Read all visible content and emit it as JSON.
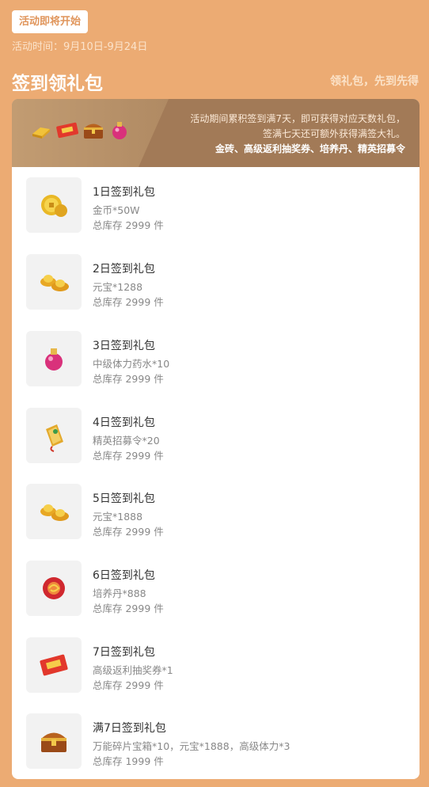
{
  "header": {
    "status": "活动即将开始",
    "time": "活动时间：9月10日-9月24日",
    "title": "签到领礼包",
    "subtitle": "领礼包，先到先得"
  },
  "banner": {
    "line1": "活动期间累积签到满7天，即可获得对应天数礼包，",
    "line2": "签满七天还可额外获得满签大礼。",
    "line3": "金砖、高级返利抽奖券、培养丹、精英招募令",
    "icons": [
      "gold-bar-icon",
      "coupon-icon",
      "treasure-chest-icon",
      "potion-icon"
    ]
  },
  "items": [
    {
      "title": "1日签到礼包",
      "desc": "金币*50W",
      "stock": "总库存 2999 件",
      "icon": "gold-coin-icon"
    },
    {
      "title": "2日签到礼包",
      "desc": "元宝*1288",
      "stock": "总库存 2999 件",
      "icon": "ingot-icon"
    },
    {
      "title": "3日签到礼包",
      "desc": "中级体力药水*10",
      "stock": "总库存 2999 件",
      "icon": "potion-icon"
    },
    {
      "title": "4日签到礼包",
      "desc": "精英招募令*20",
      "stock": "总库存 2999 件",
      "icon": "recruit-token-icon"
    },
    {
      "title": "5日签到礼包",
      "desc": "元宝*1888",
      "stock": "总库存 2999 件",
      "icon": "ingot-icon"
    },
    {
      "title": "6日签到礼包",
      "desc": "培养丹*888",
      "stock": "总库存 2999 件",
      "icon": "pill-icon"
    },
    {
      "title": "7日签到礼包",
      "desc": "高级返利抽奖券*1",
      "stock": "总库存 2999 件",
      "icon": "lottery-ticket-icon"
    },
    {
      "title": "满7日签到礼包",
      "desc": "万能碎片宝箱*10，元宝*1888，高级体力*3",
      "stock": "总库存 1999 件",
      "icon": "treasure-chest-icon"
    }
  ]
}
